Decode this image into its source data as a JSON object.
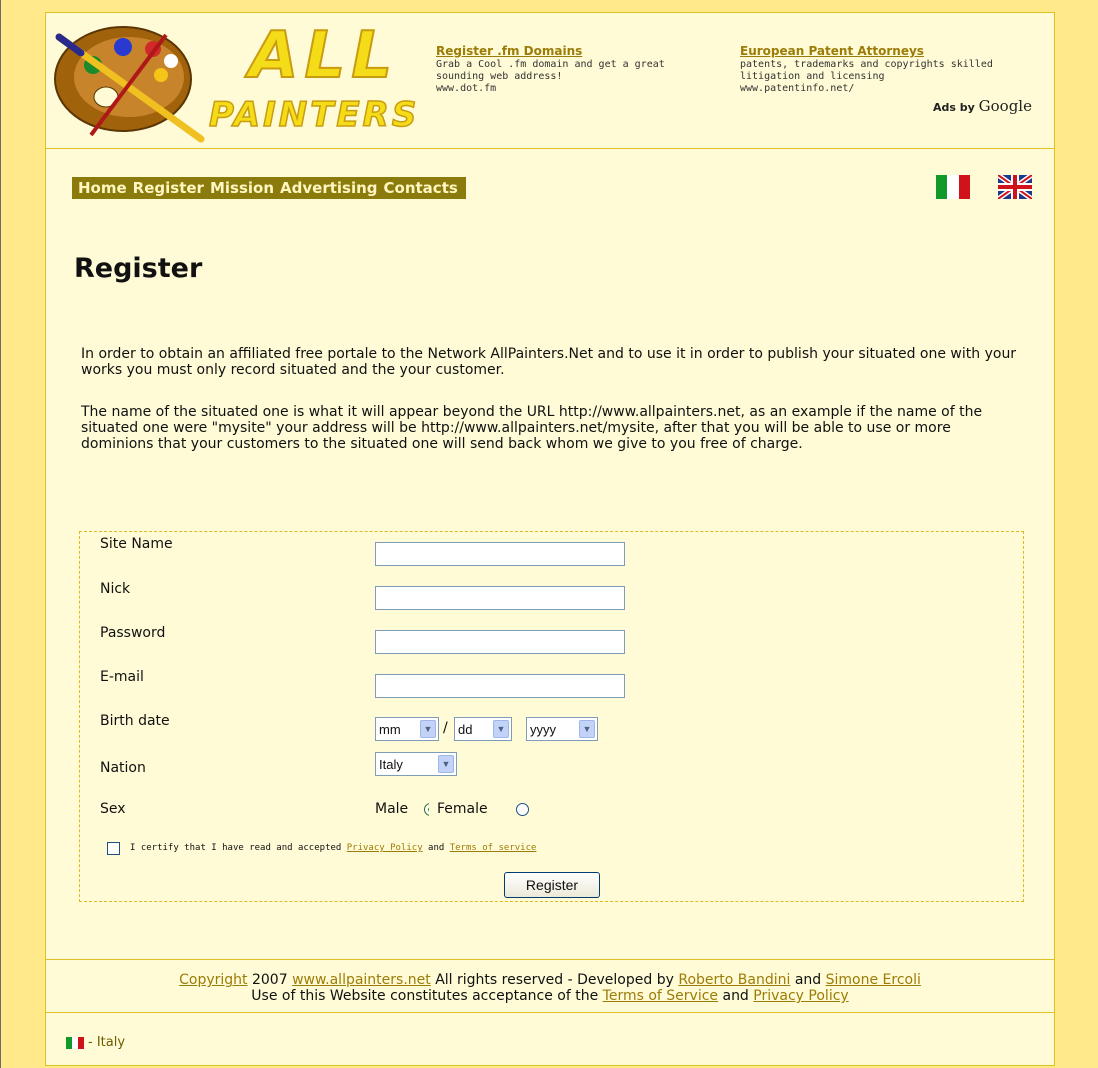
{
  "header": {
    "logo": {
      "line1": "ALL",
      "line2": "PAINTERS"
    },
    "ads": [
      {
        "title": "Register .fm Domains",
        "text": "Grab a Cool .fm domain and get a great sounding web address!",
        "url": "www.dot.fm"
      },
      {
        "title": "European Patent Attorneys",
        "text": "patents, trademarks and copyrights skilled litigation and licensing",
        "url": "www.patentinfo.net/"
      }
    ],
    "ads_by": "Ads by",
    "ads_google": "Google"
  },
  "nav": {
    "items": [
      "Home",
      "Register",
      "Mission",
      "Advertising",
      "Contacts"
    ]
  },
  "languages": [
    "Italiano",
    "English"
  ],
  "page_title": "Register",
  "intro": [
    "In order to obtain an affiliated free portale to the Network AllPainters.Net and to use it in order to publish your situated one with your works you must only record situated and the your customer.",
    "The name of the situated one is what it will appear beyond the URL http://www.allpainters.net, as an example if the name of the situated one were \"mysite\" your address will be http://www.allpainters.net/mysite, after that you will be able to use or more dominions that your customers to the situated one will send back whom we give to you free of charge."
  ],
  "form": {
    "site_name_label": "Site Name",
    "site_name_value": "",
    "nick_label": "Nick",
    "nick_value": "",
    "password_label": "Password",
    "password_value": "",
    "email_label": "E-mail",
    "email_value": "",
    "birth_label": "Birth date",
    "birth_month": "mm",
    "birth_day": "dd",
    "birth_year": "yyyy",
    "birth_sep": "/",
    "nation_label": "Nation",
    "nation_value": "Italy",
    "sex_label": "Sex",
    "sex_male": "Male",
    "sex_female": "Female",
    "certify_prefix": "I certify that I have read and accepted",
    "certify_privacy": "Privacy Policy",
    "certify_and": "and",
    "certify_terms": "Terms of service",
    "submit": "Register"
  },
  "footer": {
    "copyright_link": "Copyright",
    "year": "2007",
    "site_link": "www.allpainters.net",
    "rights": "All rights reserved - Developed by",
    "dev1": "Roberto Bandini",
    "and": "and",
    "dev2": "Simone Ercoli",
    "use_text": "Use of this Website constitutes acceptance of the",
    "tos": "Terms of Service",
    "privacy": "Privacy Policy",
    "country": "- Italy"
  },
  "colors": {
    "accent": "#9c7c08",
    "nav_bg": "#8b7b0c",
    "page_bg": "#fffbd6",
    "outer_bg": "#ffe98a"
  }
}
